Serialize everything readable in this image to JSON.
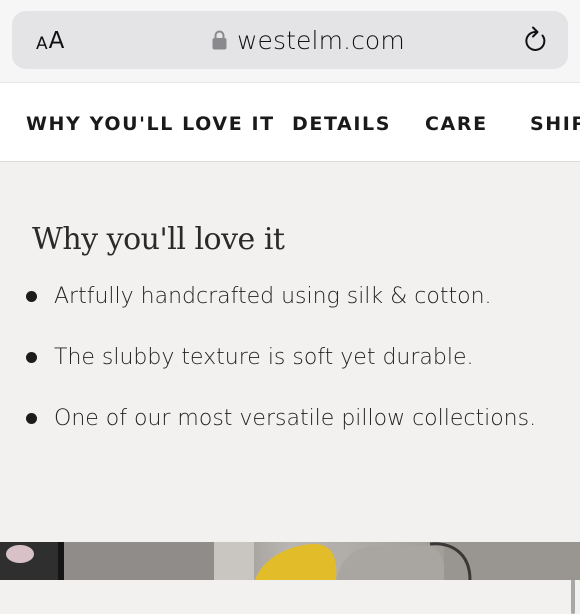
{
  "browser": {
    "text_size_small": "A",
    "text_size_big": "A",
    "url": "westelm.com"
  },
  "tabs": [
    {
      "label": "WHY YOU'LL LOVE IT"
    },
    {
      "label": "DETAILS"
    },
    {
      "label": "CARE"
    },
    {
      "label": "SHIPPING"
    }
  ],
  "section": {
    "title": "Why you'll love it",
    "bullets": [
      "Artfully handcrafted using silk & cotton.",
      "The slubby texture is soft yet durable.",
      "One of our most versatile pillow collections."
    ]
  },
  "colors": {
    "page_bg": "#f2f1f0",
    "tab_bar_bg": "#ffffff",
    "url_pill_bg": "#e4e4e6"
  }
}
